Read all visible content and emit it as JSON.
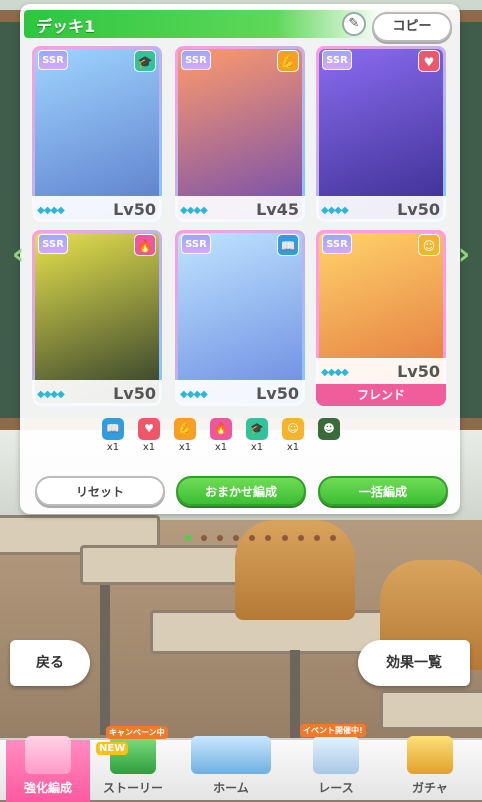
{
  "deck": {
    "title": "デッキ1",
    "copy_label": "コピー"
  },
  "cards": [
    {
      "rarity": "SSR",
      "type_icon": "wisdom-icon",
      "type_glyph": "🎓",
      "type_color": "#2fc49a",
      "level": "Lv50",
      "art": [
        "#9fd4ff",
        "#5b7cc9"
      ],
      "frame": [
        "#ff9de2",
        "#7fc8ff"
      ],
      "friend": ""
    },
    {
      "rarity": "SSR",
      "type_icon": "power-icon",
      "type_glyph": "💪",
      "type_color": "#f5a023",
      "level": "Lv45",
      "art": [
        "#ff9b6b",
        "#6e4bb0"
      ],
      "frame": [
        "#ff9de2",
        "#7fc8ff"
      ],
      "friend": ""
    },
    {
      "rarity": "SSR",
      "type_icon": "friend-icon",
      "type_glyph": "♥",
      "type_color": "#f0566a",
      "level": "Lv50",
      "art": [
        "#8a6cf0",
        "#3a2d8f"
      ],
      "frame": [
        "#ff9de2",
        "#7fc8ff"
      ],
      "friend": ""
    },
    {
      "rarity": "SSR",
      "type_icon": "guts-icon",
      "type_glyph": "🔥",
      "type_color": "#f0569a",
      "level": "Lv50",
      "art": [
        "#e6e24d",
        "#2c3a2b"
      ],
      "frame": [
        "#ff9de2",
        "#7fc8ff"
      ],
      "friend": ""
    },
    {
      "rarity": "SSR",
      "type_icon": "stamina-icon",
      "type_glyph": "📖",
      "type_color": "#2d9fe0",
      "level": "Lv50",
      "art": [
        "#bfe4ff",
        "#6a8ae0"
      ],
      "frame": [
        "#ff9de2",
        "#7fc8ff"
      ],
      "friend": ""
    },
    {
      "rarity": "SSR",
      "type_icon": "friend-smile-icon",
      "type_glyph": "☺",
      "type_color": "#f5b52a",
      "level": "Lv50",
      "art": [
        "#ffd36b",
        "#e0703a"
      ],
      "frame": [
        "#ff9de2",
        "#ff9de2"
      ],
      "friend": "フレンド"
    }
  ],
  "type_counts": [
    {
      "icon": "speed-icon",
      "glyph": "📖",
      "color": "#2d9fe0",
      "count": "x1"
    },
    {
      "icon": "friend-icon",
      "glyph": "♥",
      "color": "#f0566a",
      "count": "x1"
    },
    {
      "icon": "power-icon",
      "glyph": "💪",
      "color": "#f5a023",
      "count": "x1"
    },
    {
      "icon": "guts-icon",
      "glyph": "🔥",
      "color": "#f0569a",
      "count": "x1"
    },
    {
      "icon": "wisdom-icon",
      "glyph": "🎓",
      "color": "#2fc49a",
      "count": "x1"
    },
    {
      "icon": "group-icon",
      "glyph": "☺",
      "color": "#f5b52a",
      "count": "x1"
    },
    {
      "icon": "empty-slot-icon",
      "glyph": "☻",
      "color": "#3a6b3a",
      "count": ""
    }
  ],
  "actions": {
    "reset": "リセット",
    "auto": "おまかせ編成",
    "bulk": "一括編成"
  },
  "back_label": "戻る",
  "effects_label": "効果一覧",
  "nav": [
    {
      "label": "強化編成",
      "badge": ""
    },
    {
      "label": "ストーリー",
      "badge": "キャンペーン中"
    },
    {
      "label": "ホーム",
      "badge": ""
    },
    {
      "label": "レース",
      "badge": "イベント開催中!"
    },
    {
      "label": "ガチャ",
      "badge": ""
    }
  ],
  "story_new_badge": "NEW"
}
